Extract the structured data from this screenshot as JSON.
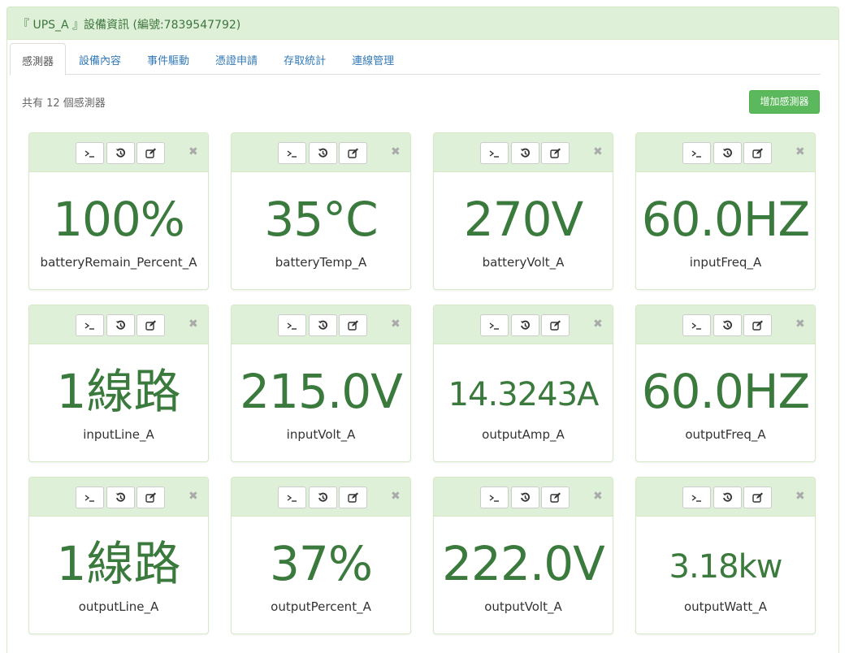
{
  "header": {
    "title": "『 UPS_A 』設備資訊 (編號:7839547792)"
  },
  "tabs": [
    {
      "label": "感測器",
      "active": true
    },
    {
      "label": "設備內容"
    },
    {
      "label": "事件驅動"
    },
    {
      "label": "憑證申請"
    },
    {
      "label": "存取統計"
    },
    {
      "label": "連線管理"
    }
  ],
  "summary": {
    "count_text": "共有 12 個感測器",
    "add_button": "增加感測器",
    "add_button_color": "#5cb85c"
  },
  "accent_color": "#3b7a3d",
  "card_buttons": [
    "terminal-icon",
    "history-icon",
    "edit-icon",
    "close-icon"
  ],
  "sensors": [
    {
      "value": "100%",
      "label": "batteryRemain_Percent_A"
    },
    {
      "value": "35°C",
      "label": "batteryTemp_A"
    },
    {
      "value": "270V",
      "label": "batteryVolt_A"
    },
    {
      "value": "60.0HZ",
      "label": "inputFreq_A"
    },
    {
      "value": "1線路",
      "label": "inputLine_A"
    },
    {
      "value": "215.0V",
      "label": "inputVolt_A"
    },
    {
      "value": "14.3243A",
      "label": "outputAmp_A"
    },
    {
      "value": "60.0HZ",
      "label": "outputFreq_A"
    },
    {
      "value": "1線路",
      "label": "outputLine_A"
    },
    {
      "value": "37%",
      "label": "outputPercent_A"
    },
    {
      "value": "222.0V",
      "label": "outputVolt_A"
    },
    {
      "value": "3.18kw",
      "label": "outputWatt_A"
    }
  ],
  "close_glyph": "✖"
}
